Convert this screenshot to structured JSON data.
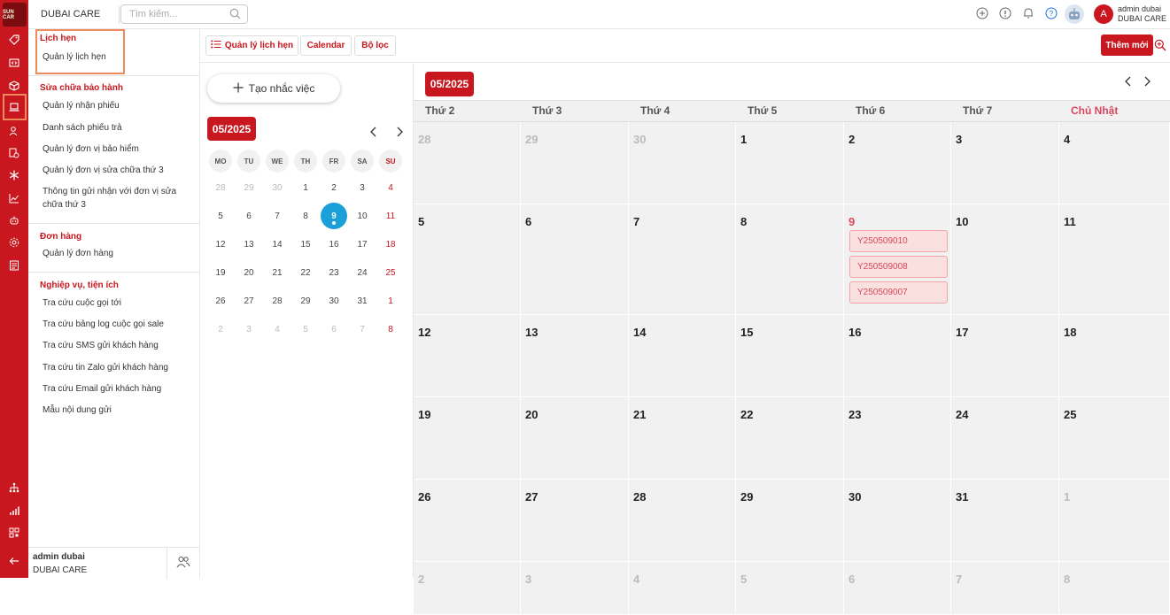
{
  "rail": {
    "logo_text": "SUN CAR"
  },
  "topbar": {
    "brand": "DUBAI CARE",
    "search_placeholder": "Tìm kiếm...",
    "avatar_initial": "A",
    "user_name": "admin dubai",
    "user_org": "DUBAI CARE"
  },
  "sidebar": {
    "sections": [
      {
        "heading": "Lịch hẹn",
        "items": [
          "Quản lý lịch hẹn"
        ]
      },
      {
        "heading": "Sửa chữa bảo hành",
        "items": [
          "Quản lý nhận phiếu",
          "Danh sách phiếu trả",
          "Quản lý đơn vị bảo hiểm",
          "Quản lý đơn vị sửa chữa thứ 3",
          "Thông tin gửi nhận với đơn vị sửa chữa thứ 3"
        ]
      },
      {
        "heading": "Đơn hàng",
        "items": [
          "Quản lý đơn hàng"
        ]
      },
      {
        "heading": "Nghiệp vụ, tiện ích",
        "items": [
          "Tra cứu cuộc gọi tới",
          "Tra cứu bảng log cuộc gọi sale",
          "Tra cứu SMS gửi khách hàng",
          "Tra cứu tin Zalo gửi khách hàng",
          "Tra cứu Email gửi khách hàng",
          "Mẫu nội dung gửi"
        ]
      }
    ],
    "footer_name": "admin dubai",
    "footer_org": "DUBAI CARE"
  },
  "toolbar": {
    "tab_manage": "Quản lý lịch hẹn",
    "tab_calendar": "Calendar",
    "tab_filter": "Bộ lọc",
    "add_button": "Thêm mới"
  },
  "mini_calendar": {
    "create_label": "Tạo nhắc việc",
    "month_label": "05/2025",
    "weekdays": [
      "MO",
      "TU",
      "WE",
      "TH",
      "FR",
      "SA",
      "SU"
    ],
    "weeks": [
      [
        "28",
        "29",
        "30",
        "1",
        "2",
        "3",
        "4"
      ],
      [
        "5",
        "6",
        "7",
        "8",
        "9",
        "10",
        "11"
      ],
      [
        "12",
        "13",
        "14",
        "15",
        "16",
        "17",
        "18"
      ],
      [
        "19",
        "20",
        "21",
        "22",
        "23",
        "24",
        "25"
      ],
      [
        "26",
        "27",
        "28",
        "29",
        "30",
        "31",
        "1"
      ],
      [
        "2",
        "3",
        "4",
        "5",
        "6",
        "7",
        "8"
      ]
    ],
    "today": "9"
  },
  "month_view": {
    "month_label": "05/2025",
    "weekdays": [
      "Thứ 2",
      "Thứ 3",
      "Thứ 4",
      "Thứ 5",
      "Thứ 6",
      "Thứ 7",
      "Chủ Nhật"
    ],
    "weeks": [
      [
        "28",
        "29",
        "30",
        "1",
        "2",
        "3",
        "4"
      ],
      [
        "5",
        "6",
        "7",
        "8",
        "9",
        "10",
        "11"
      ],
      [
        "12",
        "13",
        "14",
        "15",
        "16",
        "17",
        "18"
      ],
      [
        "19",
        "20",
        "21",
        "22",
        "23",
        "24",
        "25"
      ],
      [
        "26",
        "27",
        "28",
        "29",
        "30",
        "31",
        "1"
      ],
      [
        "2",
        "3",
        "4",
        "5",
        "6",
        "7",
        "8"
      ]
    ],
    "events_on_9": [
      "Y250509010",
      "Y250509008",
      "Y250509007"
    ]
  },
  "colors": {
    "brand_red": "#c8171e",
    "today_blue": "#1a9fd9",
    "event_pink": "#fbe0e0"
  }
}
